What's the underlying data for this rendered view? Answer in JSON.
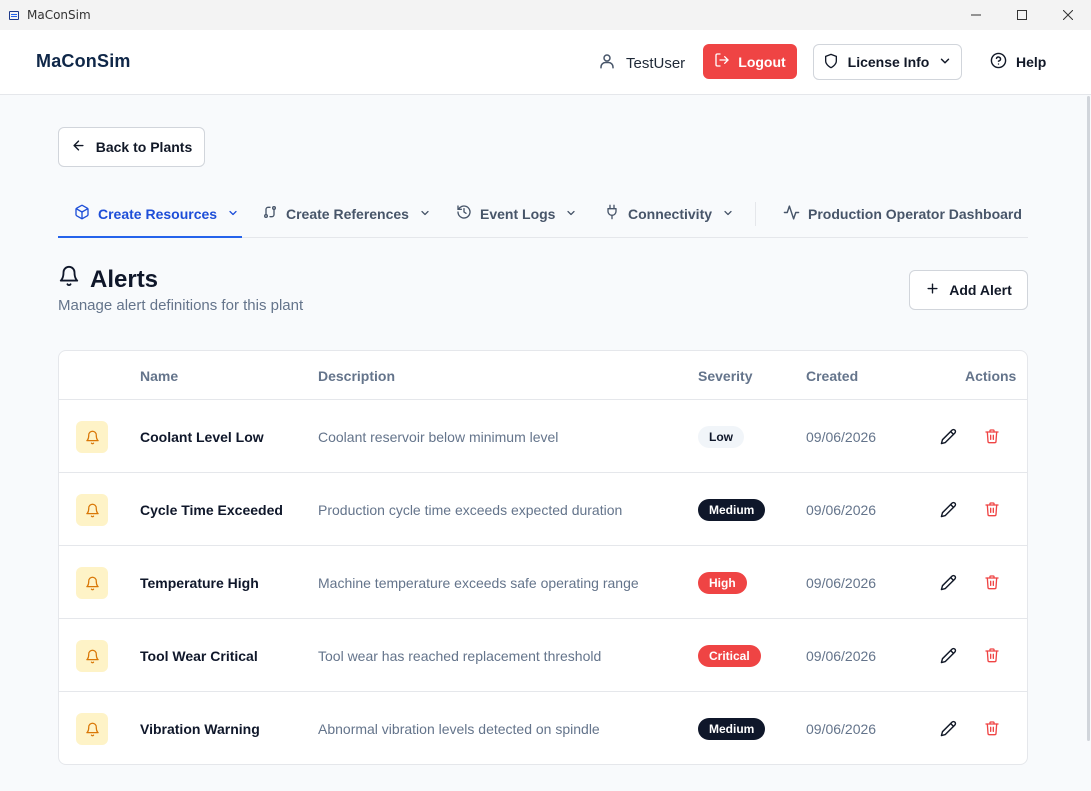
{
  "window": {
    "title": "MaConSim"
  },
  "header": {
    "brand": "MaConSim",
    "username": "TestUser",
    "logout_label": "Logout",
    "license_label": "License Info",
    "help_label": "Help"
  },
  "back_label": "Back to Plants",
  "tabs": [
    {
      "label": "Create Resources",
      "icon": "cube-icon",
      "active": true
    },
    {
      "label": "Create References",
      "icon": "link-icon",
      "active": false
    },
    {
      "label": "Event Logs",
      "icon": "history-icon",
      "active": false
    },
    {
      "label": "Connectivity",
      "icon": "plug-icon",
      "active": false
    },
    {
      "label": "Production Operator Dashboard",
      "icon": "activity-icon",
      "active": false
    }
  ],
  "page": {
    "title": "Alerts",
    "subtitle": "Manage alert definitions for this plant",
    "add_label": "Add Alert"
  },
  "table": {
    "columns": {
      "name": "Name",
      "description": "Description",
      "severity": "Severity",
      "created": "Created",
      "actions": "Actions"
    },
    "rows": [
      {
        "name": "Coolant Level Low",
        "description": "Coolant reservoir below minimum level",
        "severity": "Low",
        "created": "09/06/2026"
      },
      {
        "name": "Cycle Time Exceeded",
        "description": "Production cycle time exceeds expected duration",
        "severity": "Medium",
        "created": "09/06/2026"
      },
      {
        "name": "Temperature High",
        "description": "Machine temperature exceeds safe operating range",
        "severity": "High",
        "created": "09/06/2026"
      },
      {
        "name": "Tool Wear Critical",
        "description": "Tool wear has reached replacement threshold",
        "severity": "Critical",
        "created": "09/06/2026"
      },
      {
        "name": "Vibration Warning",
        "description": "Abnormal vibration levels detected on spindle",
        "severity": "Medium",
        "created": "09/06/2026"
      }
    ]
  },
  "colors": {
    "accent": "#2563eb",
    "danger": "#ef4444",
    "dark": "#0f172a",
    "warning_bg": "#fef3c7",
    "warning": "#d97706"
  }
}
